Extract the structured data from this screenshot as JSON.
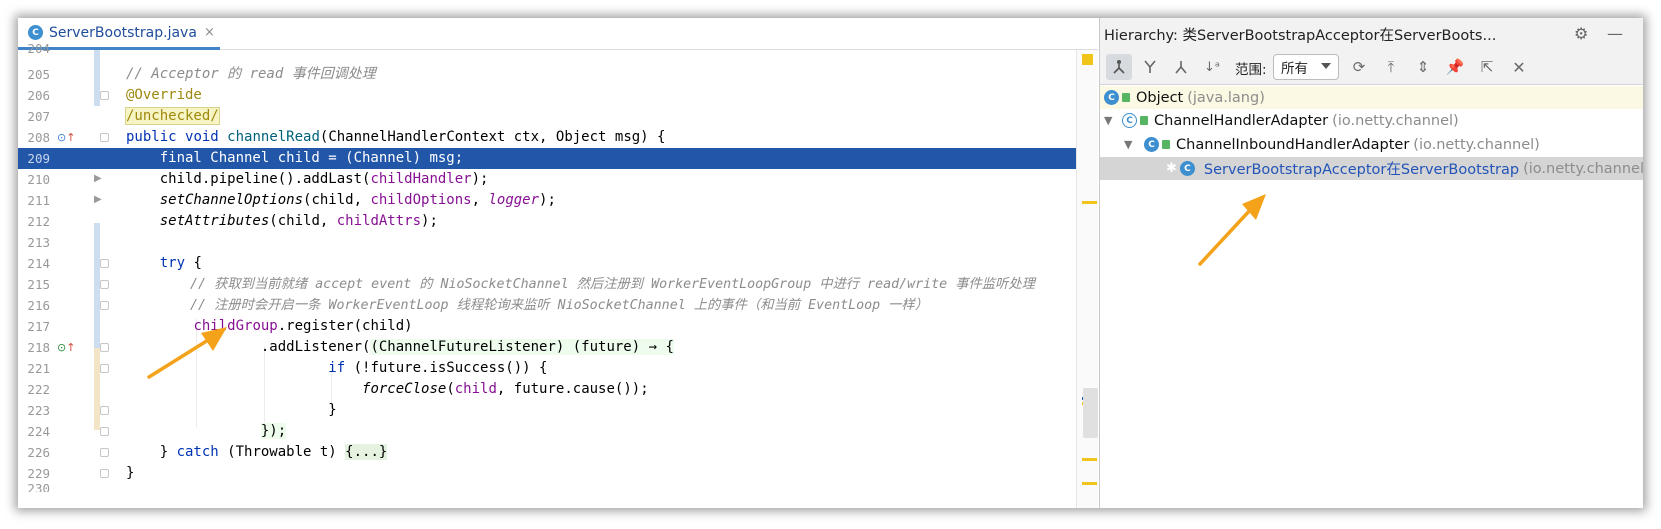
{
  "editor": {
    "tab": {
      "label": "ServerBootstrap.java",
      "close_glyph": "×"
    },
    "top_partial_number": "204",
    "bottom_partial_number": "230",
    "lines": {
      "l205": {
        "num": "205",
        "comment": "// Acceptor 的 read 事件回调处理"
      },
      "l206": {
        "num": "206",
        "annotation": "@Override"
      },
      "l207": {
        "num": "207",
        "unchecked": "/unchecked/"
      },
      "l208": {
        "num": "208",
        "kw1": "public",
        "kw2": "void",
        "method": "channelRead",
        "rest": "(ChannelHandlerContext ctx, Object msg) {"
      },
      "l209": {
        "num": "209",
        "text": "final Channel child = (Channel) msg;"
      },
      "l210": {
        "num": "210",
        "a": "child.pipeline().addLast(",
        "field": "childHandler",
        "b": ");"
      },
      "l211": {
        "num": "211",
        "method": "setChannelOptions",
        "a": "(child, ",
        "field": "childOptions",
        "b": ", ",
        "field2": "logger",
        "c": ");"
      },
      "l212": {
        "num": "212",
        "method": "setAttributes",
        "a": "(child, ",
        "field": "childAttrs",
        "b": ");"
      },
      "l213": {
        "num": "213"
      },
      "l214": {
        "num": "214",
        "kw": "try",
        "rest": " {"
      },
      "l215": {
        "num": "215",
        "comment": "// 获取到当前就绪 accept event 的 NioSocketChannel 然后注册到 WorkerEventLoopGroup 中进行 read/write 事件监听处理"
      },
      "l216": {
        "num": "216",
        "comment": "// 注册时会开启一条 WorkerEventLoop 线程轮询来监听 NioSocketChannel 上的事件（和当前 EventLoop 一样）"
      },
      "l217": {
        "num": "217",
        "field": "childGroup",
        "rest": ".register(child)"
      },
      "l218": {
        "num": "218",
        "a": ".addListener(",
        "lambda": "(ChannelFutureListener) (future) → {"
      },
      "l221": {
        "num": "221",
        "kw": "if",
        "rest": " (!future.isSuccess()) {"
      },
      "l222": {
        "num": "222",
        "method": "forceClose",
        "a": "(",
        "field": "child",
        "b": ", future.cause());"
      },
      "l223": {
        "num": "223",
        "text": "}"
      },
      "l224": {
        "num": "224",
        "text": "});"
      },
      "l226": {
        "num": "226",
        "a": "} ",
        "kw": "catch",
        "b": " (Throwable t) ",
        "folded": "{...}"
      },
      "l229": {
        "num": "229",
        "text": "}"
      }
    }
  },
  "hierarchy": {
    "title": "Hierarchy:  类ServerBootstrapAcceptor在ServerBoots...",
    "scope_label": "范围:",
    "scope_value": "所有",
    "tree": [
      {
        "name": "Object",
        "pkg": "(java.lang)"
      },
      {
        "name": "ChannelHandlerAdapter",
        "pkg": "(io.netty.channel)"
      },
      {
        "name": "ChannelInboundHandlerAdapter",
        "pkg": "(io.netty.channel)"
      },
      {
        "name": "ServerBootstrapAcceptor在ServerBootstrap",
        "pkg": "(io.netty.channel)"
      }
    ]
  },
  "icons": {
    "class_icon": "C",
    "gear": "⚙",
    "minimize": "—",
    "tree_expanded": "▼",
    "bookmark": "✱"
  },
  "colors": {
    "keyword": "#0033b3",
    "comment": "#8c8c8c",
    "annotation": "#9e880d",
    "method": "#00627a",
    "field": "#871094",
    "selection": "#2256a8",
    "arrow": "#f4a21a"
  }
}
